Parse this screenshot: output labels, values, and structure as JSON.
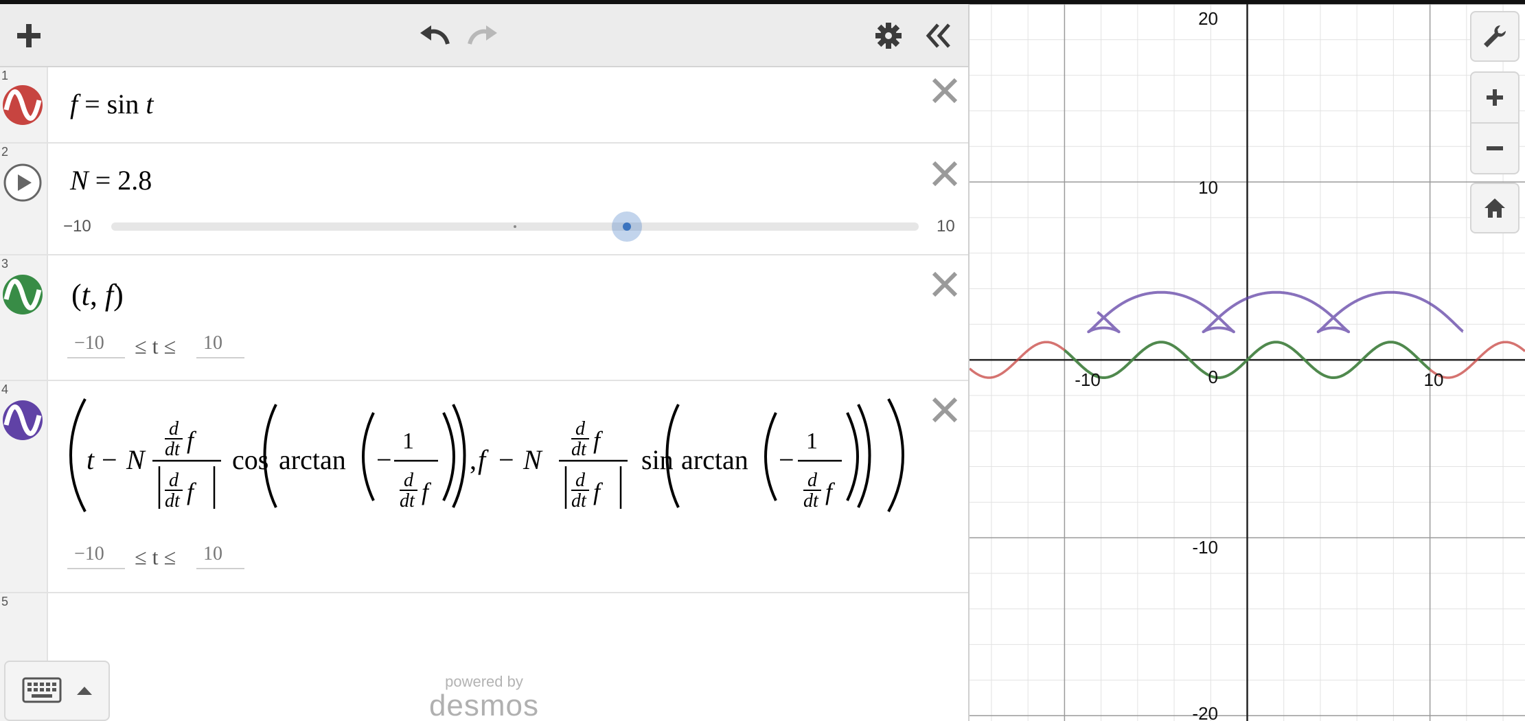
{
  "toolbar": {
    "add_icon": "plus-icon",
    "undo_icon": "undo-icon",
    "redo_icon": "redo-icon",
    "settings_icon": "gear-icon",
    "collapse_icon": "double-chevron-left-icon"
  },
  "expressions": [
    {
      "number": "1",
      "color": "#c74440",
      "icon": "sine-wave-icon",
      "latex": "f = sin t"
    },
    {
      "number": "2",
      "icon": "play-icon",
      "latex": "N = 2.8",
      "slider": {
        "min": "−10",
        "max": "10",
        "value": 2.8
      }
    },
    {
      "number": "3",
      "color": "#388c46",
      "icon": "sine-wave-icon",
      "latex": "(t, f)",
      "domain": {
        "min": "−10",
        "max": "10",
        "relation": "≤ t ≤"
      }
    },
    {
      "number": "4",
      "color": "#6042a6",
      "icon": "sine-wave-icon",
      "latex": "(t − N (d/dt f)/|d/dt f| cos(arctan(−1/(d/dt f))), f − N (d/dt f)/|d/dt f| sin(arctan(−1/(d/dt f))))",
      "domain": {
        "min": "−10",
        "max": "10",
        "relation": "≤ t ≤"
      }
    },
    {
      "number": "5"
    }
  ],
  "footer": {
    "powered_by": "powered by",
    "brand": "desmos",
    "keyboard_icon": "keyboard-icon"
  },
  "graph": {
    "x_range": [
      -15.2,
      15.2
    ],
    "y_range": [
      -20.3,
      20.0
    ],
    "tick_labels": {
      "y_top": "20",
      "y_10": "10",
      "y_neg10": "-10",
      "y_bottom": "-20",
      "x_neg10": "-10",
      "x_10": "10",
      "origin": "0"
    },
    "grid": true,
    "colors": {
      "red": "#c74440",
      "green": "#388c46",
      "purple": "#6042a6"
    }
  },
  "side_controls": {
    "wrench_icon": "wrench-icon",
    "zoom_in_icon": "plus-icon",
    "zoom_out_icon": "minus-icon",
    "home_icon": "home-icon"
  },
  "chart_data": {
    "type": "line",
    "series": [
      {
        "name": "",
        "kind": "function",
        "expr": "sin t",
        "x_range": [
          -15.2,
          15.2
        ],
        "color": "#c74440"
      },
      {
        "name": "",
        "kind": "parametric",
        "expr": "(t, sin t)",
        "t_range": [
          -10,
          10
        ],
        "color": "#388c46"
      },
      {
        "name": "",
        "kind": "parametric",
        "expr": "offset curve of sin t by N=2.8",
        "t_range": [
          -10,
          10
        ],
        "color": "#6042a6"
      }
    ],
    "xlim": [
      -15.2,
      15.2
    ],
    "ylim": [
      -20.3,
      20.0
    ],
    "grid": true
  }
}
